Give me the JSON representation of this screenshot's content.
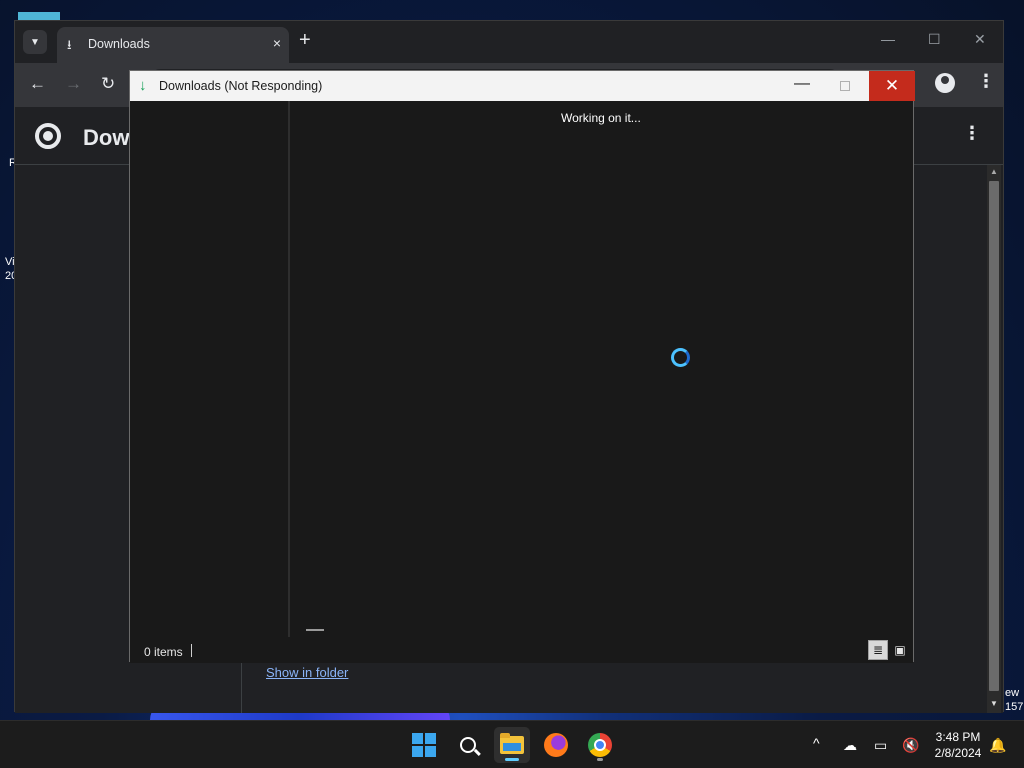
{
  "desktop": {
    "left_fragments": [
      "R",
      "Vi",
      "20"
    ],
    "right_fragments": [
      "ew",
      "157"
    ]
  },
  "chrome": {
    "tab": {
      "title": "Downloads",
      "close": "×"
    },
    "new_tab": "+",
    "window_controls": {
      "minimize": "—",
      "maximize": "☐",
      "close": "✕"
    },
    "nav": {
      "back": "←",
      "forward": "→",
      "reload": "↻"
    },
    "kebab": "⋮",
    "page": {
      "title": "Dow",
      "show_in_folder": "Show in folder"
    }
  },
  "explorer": {
    "title": "Downloads (Not Responding)",
    "title_icon": "↓",
    "minimize": "—",
    "close": "✕",
    "working_text": "Working on it...",
    "status_items": "0 items",
    "view_details": "≣",
    "view_tiles": "▣"
  },
  "taskbar": {
    "tray_chevron": "^",
    "time": "3:48 PM",
    "date": "2/8/2024",
    "accent": "#60cdff"
  }
}
